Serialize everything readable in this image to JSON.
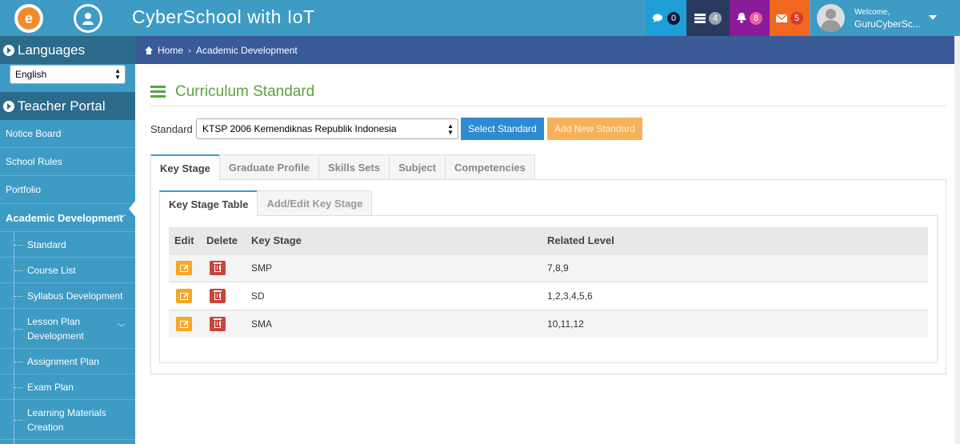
{
  "app": {
    "title": "CyberSchool with IoT"
  },
  "header": {
    "notifications": [
      {
        "name": "chat",
        "count": "0"
      },
      {
        "name": "tasks",
        "count": "4"
      },
      {
        "name": "alerts",
        "count": "8"
      },
      {
        "name": "mail",
        "count": "5"
      }
    ],
    "user": {
      "welcome": "Welcome,",
      "name": "GuruCyberSc..."
    }
  },
  "sidebar": {
    "languages_title": "Languages",
    "language_value": "English",
    "portal_title": "Teacher Portal",
    "items": [
      "Notice Board",
      "School Rules",
      "Portfolio",
      "Academic Development"
    ],
    "sub_items": [
      "Standard",
      "Course List",
      "Syllabus Development",
      "Lesson Plan Development",
      "Assignment Plan",
      "Exam Plan",
      "Learning Materials Creation"
    ]
  },
  "breadcrumb": {
    "home": "Home",
    "current": "Academic Development"
  },
  "main": {
    "title": "Curriculum Standard",
    "standard_label": "Standard",
    "standard_value": "KTSP 2006 Kemendiknas Republik Indonesia",
    "select_button": "Select Standard",
    "add_button": "Add New Standard",
    "tabs": [
      "Key Stage",
      "Graduate Profile",
      "Skills Sets",
      "Subject",
      "Competencies"
    ],
    "subtabs": [
      "Key Stage Table",
      "Add/Edit Key Stage"
    ],
    "table": {
      "headers": [
        "Edit",
        "Delete",
        "Key Stage",
        "Related Level"
      ],
      "rows": [
        {
          "key_stage": "SMP",
          "level": "7,8,9"
        },
        {
          "key_stage": "SD",
          "level": "1,2,3,4,5,6"
        },
        {
          "key_stage": "SMA",
          "level": "10,11,12"
        }
      ]
    }
  },
  "colors": {
    "header": "#3d9bc4",
    "breadcrumb": "#3a5a98",
    "title_green": "#5aa53a",
    "edit_orange": "#f5a623",
    "delete_red": "#c9443a"
  }
}
